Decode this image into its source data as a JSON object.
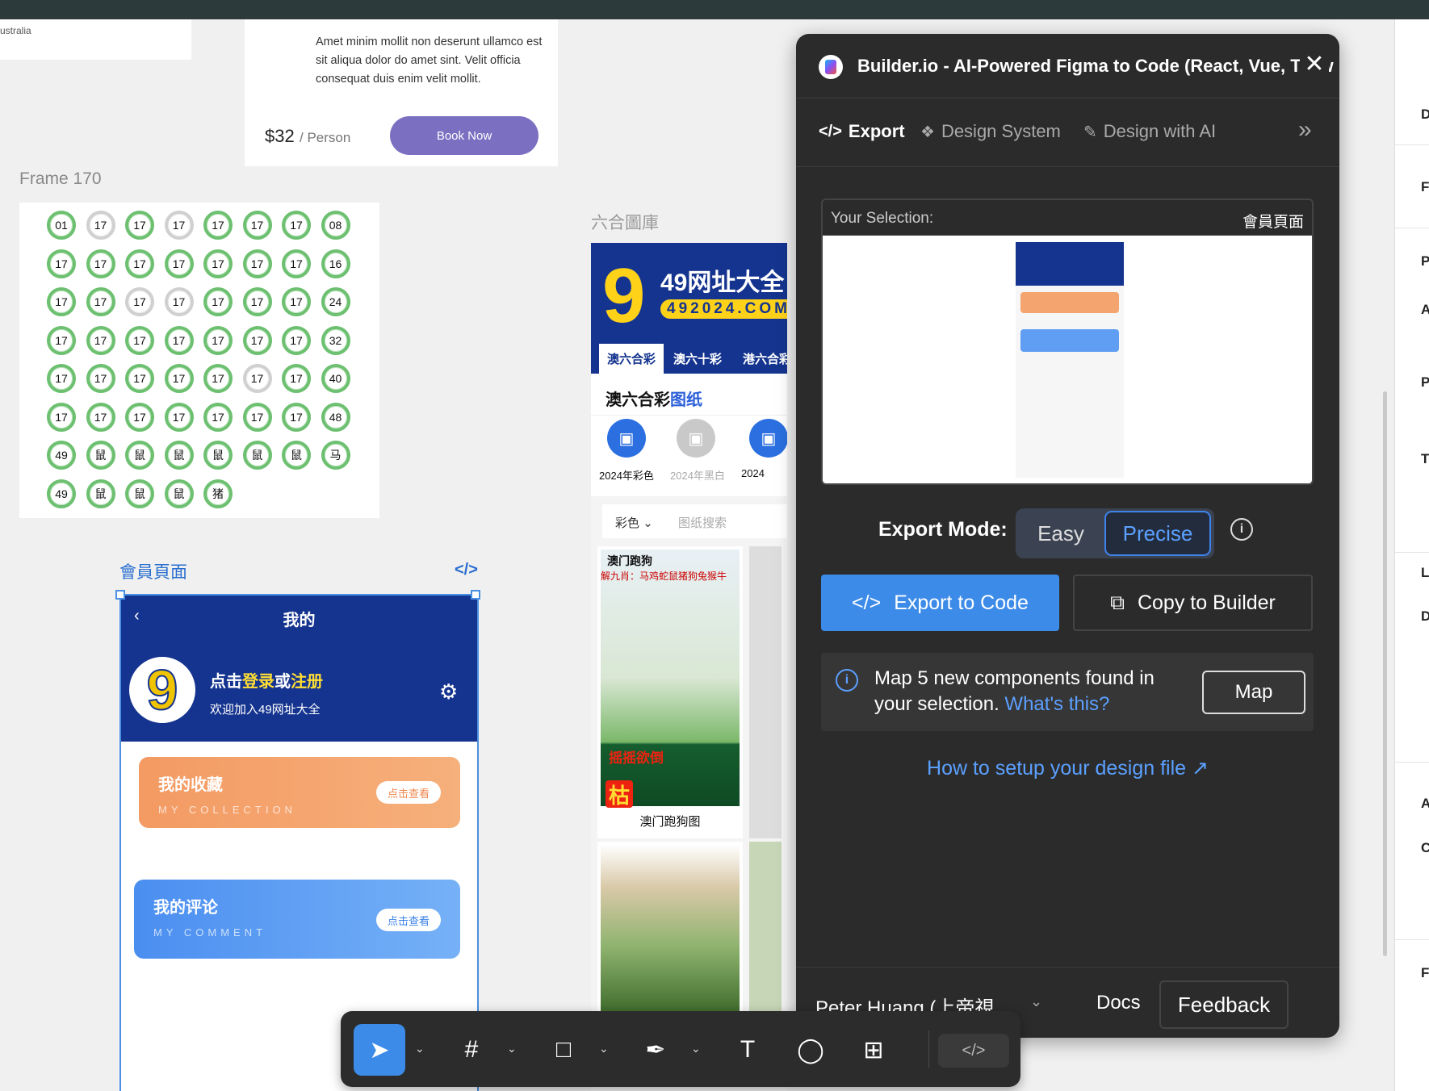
{
  "canvas": {
    "australia_card": {
      "text": "ustralia"
    },
    "tour_card": {
      "description": "Amet minim mollit non deserunt ullamco est sit aliqua dolor do amet sint. Velit officia consequat duis enim velit mollit.",
      "price": "$32",
      "unit": "/ Person",
      "book_button": "Book Now"
    },
    "frame170": {
      "label": "Frame 170",
      "rows": [
        [
          "01",
          "17",
          "17",
          "17",
          "17",
          "17",
          "17",
          "08"
        ],
        [
          "17",
          "17",
          "17",
          "17",
          "17",
          "17",
          "17",
          "16"
        ],
        [
          "17",
          "17",
          "17",
          "17",
          "17",
          "17",
          "17",
          "24"
        ],
        [
          "17",
          "17",
          "17",
          "17",
          "17",
          "17",
          "17",
          "32"
        ],
        [
          "17",
          "17",
          "17",
          "17",
          "17",
          "17",
          "17",
          "40"
        ],
        [
          "17",
          "17",
          "17",
          "17",
          "17",
          "17",
          "17",
          "48"
        ],
        [
          "49",
          "鼠",
          "鼠",
          "鼠",
          "鼠",
          "鼠",
          "鼠",
          "马"
        ],
        [
          "49",
          "鼠",
          "鼠",
          "鼠",
          "猪"
        ]
      ],
      "gray_cells": [
        "0-1",
        "0-3",
        "2-2",
        "2-3",
        "4-5"
      ]
    },
    "member_page": {
      "label": "會員頁面",
      "code_icon": "</>",
      "title": "我的",
      "back": "‹",
      "login_prefix": "点击",
      "login_word": "登录",
      "or_word": "或",
      "register_word": "注册",
      "welcome": "欢迎加入49网址大全",
      "collection_title": "我的收藏",
      "collection_sub": "MY COLLECTION",
      "collection_btn": "点击查看",
      "comment_title": "我的评论",
      "comment_sub": "MY COMMENT",
      "comment_btn": "点击查看"
    },
    "gallery": {
      "label": "六合圖庫",
      "logo_number": "9",
      "site_name": "49网址大全",
      "domain": "492024.COM",
      "tabs": [
        "澳六合彩",
        "澳六十彩",
        "港六合彩"
      ],
      "section_title_a": "澳六合彩",
      "section_title_b": "图纸",
      "icons": [
        "2024年彩色",
        "2024年黑白",
        "2024"
      ],
      "filter_select": "彩色",
      "filter_placeholder": "图纸搜索",
      "pic1_title": "澳门跑狗",
      "pic1_sub": "解九肖：马鸡蛇鼠猪狗兔猴牛",
      "pic1_banner": "摇摇欲倒",
      "pic1_big": "枯",
      "pic1_caption": "澳门跑狗图"
    }
  },
  "plugin": {
    "title": "Builder.io - AI-Powered Figma to Code (React, Vue, Tailwind & more)",
    "close": "✕",
    "tabs": [
      {
        "label": "Export",
        "icon": "</>"
      },
      {
        "label": "Design System",
        "icon": "❖"
      },
      {
        "label": "Design with AI",
        "icon": "✎"
      }
    ],
    "more": "»",
    "selection_label": "Your Selection:",
    "selection_name": "會員頁面",
    "export_mode_label": "Export Mode:",
    "mode_easy": "Easy",
    "mode_precise": "Precise",
    "export_button": "Export to Code",
    "copy_button": "Copy to Builder",
    "map_text": "Map 5 new components found in your selection.",
    "map_link": "What's this?",
    "map_button": "Map",
    "setup_link": "How to setup your design file",
    "user": "Peter Huang (上帝視...",
    "docs": "Docs",
    "feedback": "Feedback"
  },
  "right_panel": {
    "letters": [
      "D",
      "F",
      "P",
      "A",
      "P",
      "T",
      "L",
      "D",
      "A",
      "C",
      "F"
    ]
  },
  "colors": {
    "accent": "#3d8be8",
    "brand_blue": "#15348f",
    "plugin_bg": "#2b2b2b"
  }
}
